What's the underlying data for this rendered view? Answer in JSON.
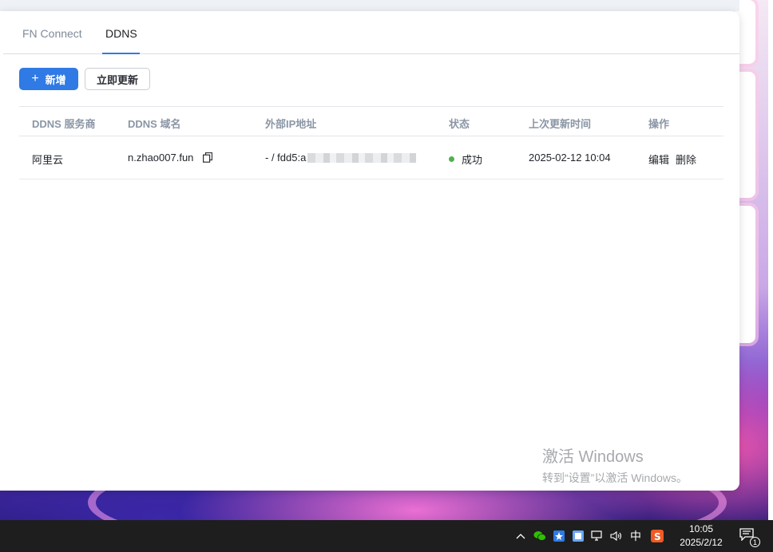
{
  "tabs": [
    {
      "label": "FN Connect",
      "active": false
    },
    {
      "label": "DDNS",
      "active": true
    }
  ],
  "toolbar": {
    "add_label": "新增",
    "add_icon": "plus-icon",
    "update_label": "立即更新"
  },
  "table": {
    "headers": [
      "DDNS 服务商",
      "DDNS 域名",
      "外部IP地址",
      "状态",
      "上次更新时间",
      "操作"
    ],
    "rows": [
      {
        "provider": "阿里云",
        "domain": "n.zhao007.fun",
        "ip": "- / fdd5:a",
        "status": "成功",
        "status_color": "#52b04c",
        "updated": "2025-02-12 10:04",
        "edit": "编辑",
        "delete": "删除"
      }
    ]
  },
  "watermark": {
    "title": "激活 Windows",
    "subtitle": "转到“设置”以激活 Windows。"
  },
  "taskbar": {
    "ime": "中",
    "time": "10:05",
    "date": "2025/2/12",
    "notification_count": "1"
  },
  "colors": {
    "accent": "#2f7ae5",
    "success": "#52b04c"
  }
}
